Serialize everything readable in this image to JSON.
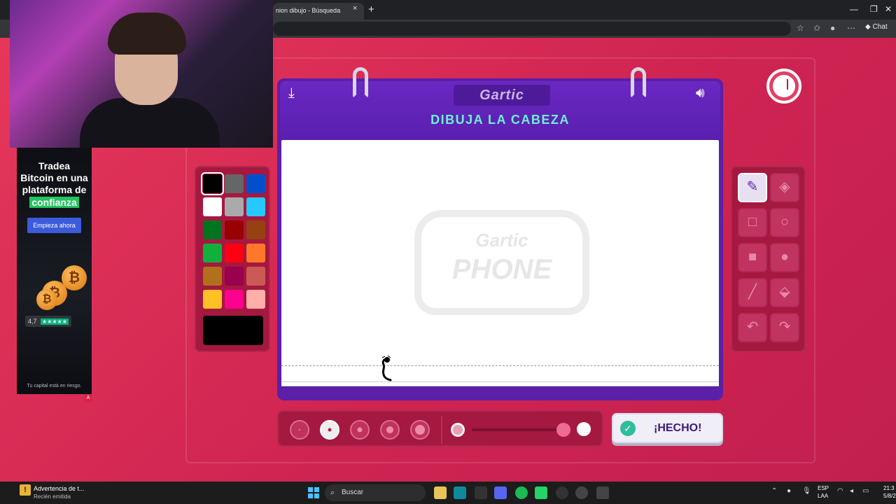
{
  "browser": {
    "tab_title": "nion dibujo - Búsqueda",
    "tab_close": "×",
    "new_tab": "+",
    "chat_label": "Chat"
  },
  "ad": {
    "title_line1": "Tradea",
    "title_line2": "Bitcoin en una",
    "title_line3": "plataforma de",
    "highlight": "confianza",
    "cta": "Empieza ahora",
    "rating": "4,7",
    "stars": "★★★★★",
    "disclaimer": "Tu capital está en riesgo."
  },
  "game": {
    "logo": "Gartic",
    "prompt": "DIBUJA LA CABEZA",
    "watermark_top": "Gartic",
    "watermark_bottom": "PHONE",
    "done_label": "¡HECHO!",
    "palette": [
      "#000000",
      "#666666",
      "#0050cd",
      "#ffffff",
      "#aaaaaa",
      "#26c9ff",
      "#017420",
      "#990000",
      "#964112",
      "#11b03c",
      "#ff0013",
      "#ff7829",
      "#b0701c",
      "#99004e",
      "#cb5a57",
      "#ffc126",
      "#ff008f",
      "#feafa8"
    ],
    "selected_color": "#000000",
    "tools": [
      {
        "name": "pen-tool",
        "icon": "pencil-icon",
        "glyph": "✎",
        "active": true
      },
      {
        "name": "eraser-tool",
        "icon": "eraser-icon",
        "glyph": "◈",
        "active": false
      },
      {
        "name": "rectangle-outline-tool",
        "icon": "square-outline-icon",
        "glyph": "□",
        "active": false
      },
      {
        "name": "ellipse-outline-tool",
        "icon": "circle-outline-icon",
        "glyph": "○",
        "active": false
      },
      {
        "name": "rectangle-filled-tool",
        "icon": "square-filled-icon",
        "glyph": "■",
        "active": false
      },
      {
        "name": "ellipse-filled-tool",
        "icon": "circle-filled-icon",
        "glyph": "●",
        "active": false
      },
      {
        "name": "line-tool",
        "icon": "line-icon",
        "glyph": "╱",
        "active": false
      },
      {
        "name": "fill-tool",
        "icon": "paint-bucket-icon",
        "glyph": "⬙",
        "active": false
      },
      {
        "name": "undo-button",
        "icon": "undo-icon",
        "glyph": "↶",
        "active": false
      },
      {
        "name": "redo-button",
        "icon": "redo-icon",
        "glyph": "↷",
        "active": false
      }
    ],
    "brush_sizes": [
      {
        "name": "brush-size-1",
        "dot": 2,
        "active": false
      },
      {
        "name": "brush-size-2",
        "dot": 5,
        "active": true
      },
      {
        "name": "brush-size-3",
        "dot": 7,
        "active": false
      },
      {
        "name": "brush-size-4",
        "dot": 10,
        "active": false
      },
      {
        "name": "brush-size-5",
        "dot": 14,
        "active": false
      }
    ],
    "opacity_level": 0.9
  },
  "taskbar": {
    "notif_title": "Advertencia de t...",
    "notif_sub": "Recién emitida",
    "search": "Buscar",
    "lang1": "ESP",
    "lang2": "LAA",
    "time": "21:3",
    "date": "5/8/202"
  }
}
